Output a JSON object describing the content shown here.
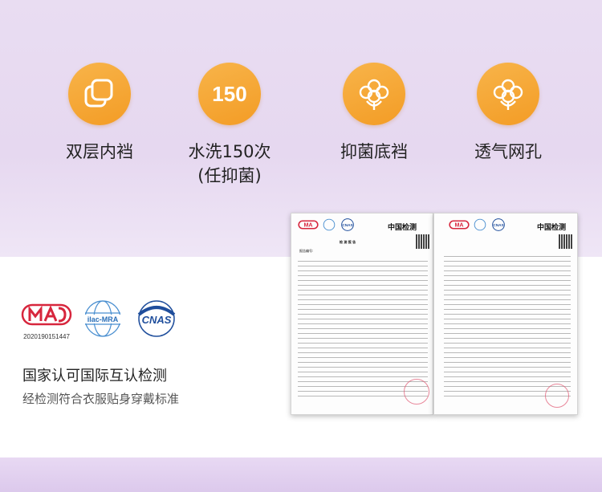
{
  "features": [
    {
      "label": "双层内裆",
      "icon": "layers-icon"
    },
    {
      "label": "水洗150次",
      "label2": "(任抑菌)",
      "badge_text": "150"
    },
    {
      "label": "抑菌底裆",
      "icon": "cotton-icon"
    },
    {
      "label": "透气网孔",
      "icon": "cotton-icon"
    }
  ],
  "certs": {
    "cma_number": "2020190151447",
    "title": "国家认可国际互认检测",
    "subtitle": "经检测符合衣服贴身穿戴标准"
  },
  "reports": [
    {
      "org": "中国检测",
      "title": "检 测 报 告",
      "report_no": "报告编号:"
    },
    {
      "org": "中国检测"
    }
  ],
  "colors": {
    "accent": "#f5a52f",
    "lavender": "#e6d8f0",
    "cma_red": "#d7263d",
    "cnas_blue": "#1f4e9c"
  }
}
